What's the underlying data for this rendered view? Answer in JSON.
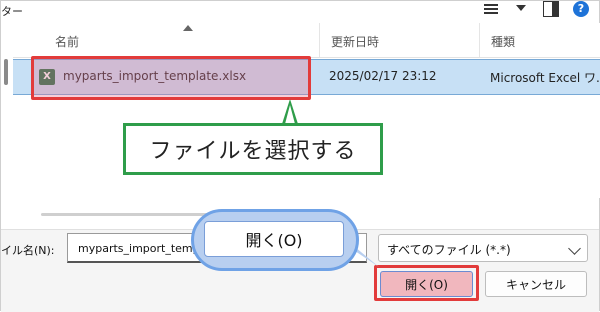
{
  "toolbar": {
    "title": "ター",
    "icons": [
      "menu-icon",
      "chevron-down-icon",
      "preview-pane-icon",
      "help-icon"
    ],
    "help_glyph": "?"
  },
  "list": {
    "headers": [
      "名前",
      "更新日時",
      "種類"
    ],
    "rows": [
      {
        "name": "myparts_import_template.xlsx",
        "date": "2025/02/17 23:12",
        "type": "Microsoft Excel ワ...",
        "icon": "excel-file-icon",
        "icon_glyph": "X"
      }
    ]
  },
  "callout": {
    "text": "ファイルを選択する"
  },
  "filename": {
    "label": "イル名(N):",
    "value": "myparts_import_temp"
  },
  "filetype": {
    "selected": "すべてのファイル (*.*)"
  },
  "buttons": {
    "open": "開く(O)",
    "cancel": "キャンセル"
  },
  "bubble": {
    "text": "開く(O)"
  },
  "colors": {
    "highlight_red": "#e23b3b",
    "callout_green": "#2f9d4a",
    "selection_blue": "#c7e0f5",
    "bubble_blue": "#b8cff0",
    "excel_green": "#1f7244"
  }
}
